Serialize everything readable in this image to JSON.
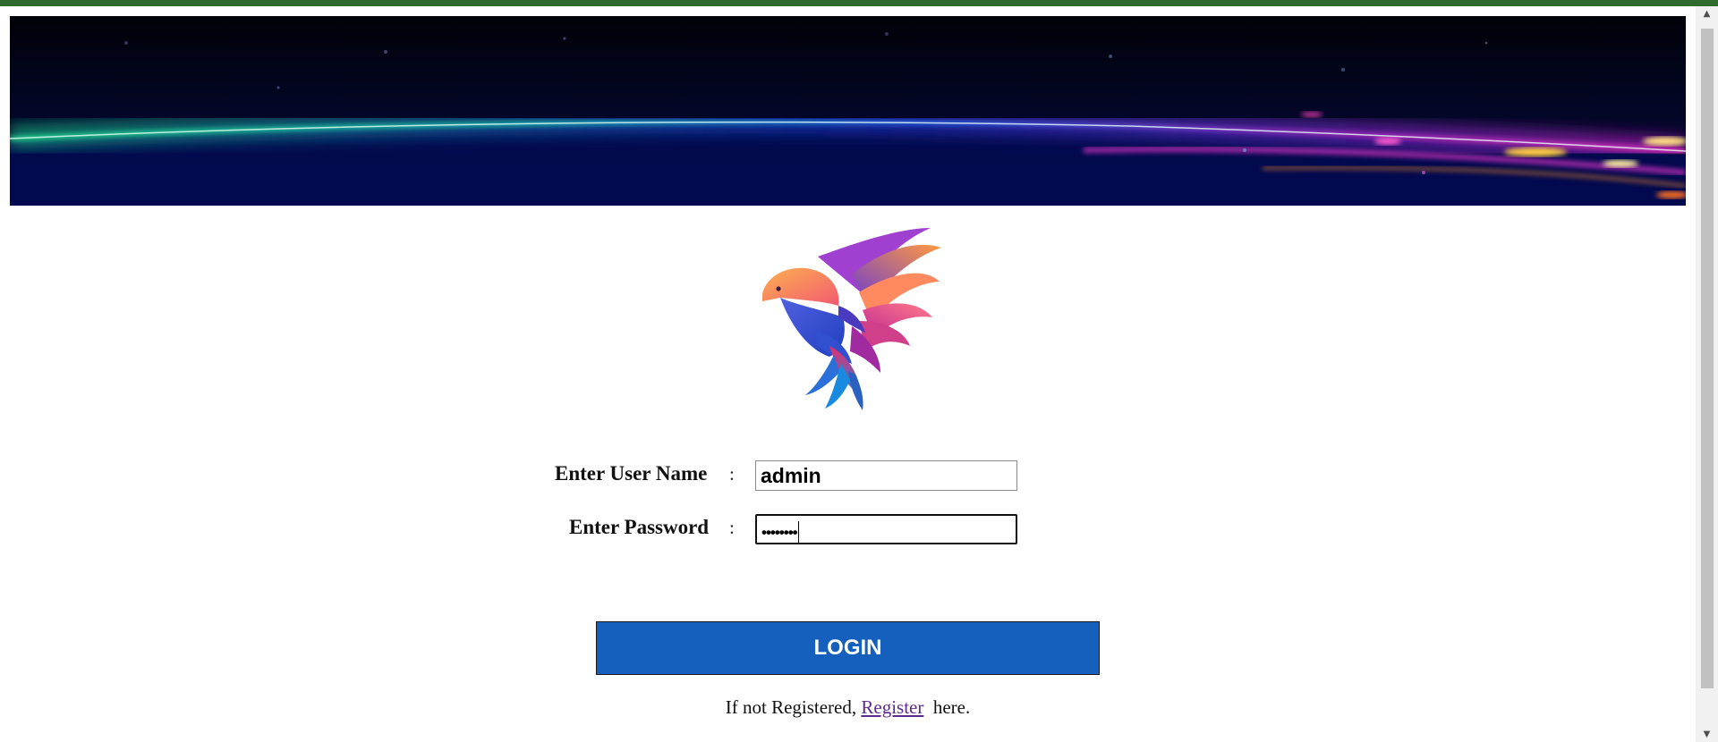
{
  "form": {
    "username_label": "Enter User Name",
    "password_label": "Enter Password",
    "colon": ":",
    "username_value": "admin",
    "password_masked": "••••••••"
  },
  "login_button": {
    "label": "LOGIN"
  },
  "register": {
    "prefix": "If not Registered,",
    "link_text": "Register",
    "suffix": "here."
  },
  "colors": {
    "top_stripe": "#2e6b2e",
    "login_button_bg": "#1560bd",
    "register_link": "#5a2b8c"
  },
  "icons": {
    "banner": "aurora-light-streak-banner",
    "logo": "colorful-bird-logo"
  }
}
